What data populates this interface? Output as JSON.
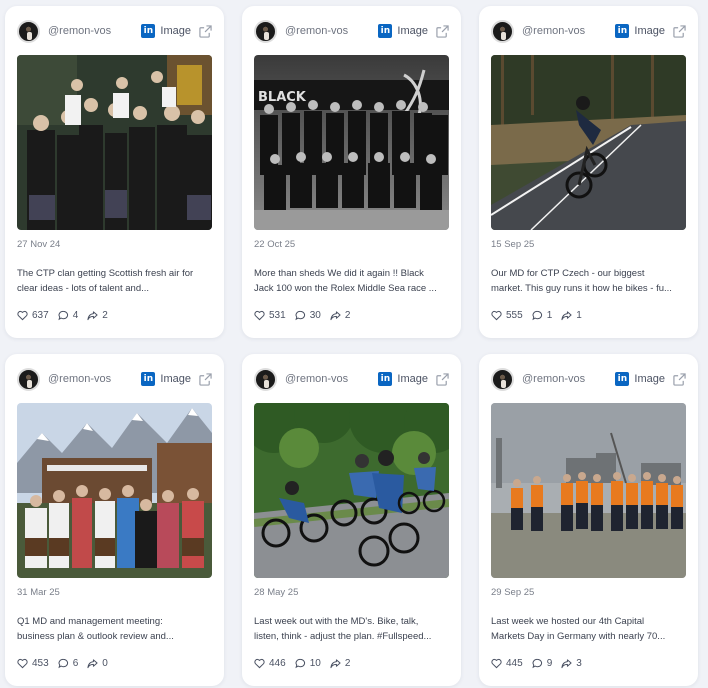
{
  "posts": [
    {
      "handle": "@remon-vos",
      "network_icon": "linkedin-icon",
      "type": "Image",
      "date": "27 Nov 24",
      "caption_line1": "The CTP clan getting Scottish fresh air for",
      "caption_line2": "clear ideas - lots of talent and...",
      "likes": "637",
      "comments": "4",
      "shares": "2"
    },
    {
      "handle": "@remon-vos",
      "network_icon": "linkedin-icon",
      "type": "Image",
      "date": "22 Oct 25",
      "caption_line1": "More than sheds We did it again !! Black",
      "caption_line2": "Jack 100 won the Rolex Middle Sea race ...",
      "likes": "531",
      "comments": "30",
      "shares": "2"
    },
    {
      "handle": "@remon-vos",
      "network_icon": "linkedin-icon",
      "type": "Image",
      "date": "15 Sep 25",
      "caption_line1": "Our MD for CTP Czech - our biggest",
      "caption_line2": "market. This guy runs it how he bikes - fu...",
      "likes": "555",
      "comments": "1",
      "shares": "1"
    },
    {
      "handle": "@remon-vos",
      "network_icon": "linkedin-icon",
      "type": "Image",
      "date": "31 Mar 25",
      "caption_line1": "Q1 MD and management meeting:",
      "caption_line2": "business plan & outlook review and...",
      "likes": "453",
      "comments": "6",
      "shares": "0"
    },
    {
      "handle": "@remon-vos",
      "network_icon": "linkedin-icon",
      "type": "Image",
      "date": "28 May 25",
      "caption_line1": "Last week out with the MD's. Bike, talk,",
      "caption_line2": "listen, think - adjust the plan. #Fullspeed...",
      "likes": "446",
      "comments": "10",
      "shares": "2"
    },
    {
      "handle": "@remon-vos",
      "network_icon": "linkedin-icon",
      "type": "Image",
      "date": "29 Sep 25",
      "caption_line1": "Last week we hosted our 4th Capital",
      "caption_line2": "Markets Day in Germany with nearly 70...",
      "likes": "445",
      "comments": "9",
      "shares": "3"
    }
  ],
  "linkedin_glyph": "in",
  "colors": {
    "linkedin": "#0a66c2",
    "card": "#ffffff",
    "background": "#f0f2f7"
  }
}
